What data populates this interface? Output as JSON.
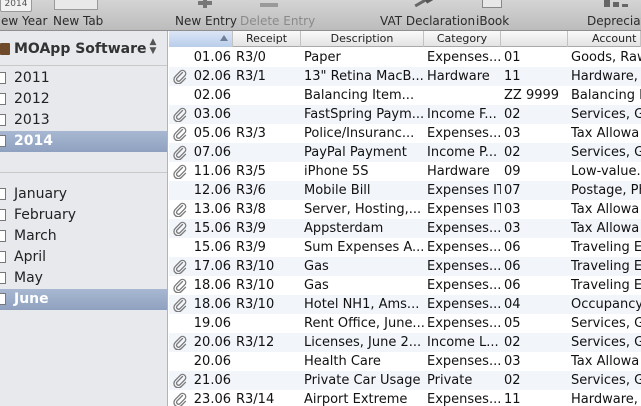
{
  "toolbar": {
    "new_year": "New Year",
    "new_tab": "New Tab",
    "new_entry": "New Entry",
    "delete_entry": "Delete Entry",
    "vat_declaration": "VAT Declaration",
    "ibook": "iBook",
    "depreciations": "Depreciations",
    "calendar_icon_text": "2014"
  },
  "sidebar": {
    "document_title": "MOApp Software",
    "years": [
      "2011",
      "2012",
      "2013",
      "2014"
    ],
    "selected_year": "2014",
    "months": [
      "January",
      "February",
      "March",
      "April",
      "May",
      "June"
    ],
    "selected_month": "June"
  },
  "table": {
    "columns": {
      "date": "",
      "receipt": "Receipt",
      "description": "Description",
      "category": "Category",
      "code": "",
      "account": "Account"
    },
    "rows": [
      {
        "attachment": false,
        "date": "01.06",
        "receipt": "R3/0",
        "description": "Paper",
        "category": "Expenses...",
        "code": "01",
        "account": "Goods, Raw"
      },
      {
        "attachment": true,
        "date": "02.06",
        "receipt": "R3/1",
        "description": "13\" Retina MacB...",
        "category": "Hardware",
        "code": "11",
        "account": "Hardware, T"
      },
      {
        "attachment": false,
        "date": "02.06",
        "receipt": "",
        "description": "Balancing Item...",
        "category": "",
        "code": "ZZ 9999",
        "account": "Balancing It"
      },
      {
        "attachment": true,
        "date": "03.06",
        "receipt": "",
        "description": "FastSpring Paym...",
        "category": "Income F...",
        "code": "02",
        "account": "Services, Ga"
      },
      {
        "attachment": true,
        "date": "05.06",
        "receipt": "R3/3",
        "description": "Police/Insuranc...",
        "category": "Expenses...",
        "code": "03",
        "account": "Tax Allowa"
      },
      {
        "attachment": true,
        "date": "07.06",
        "receipt": "",
        "description": "PayPal Payment",
        "category": "Income P...",
        "code": "02",
        "account": "Services, Ga"
      },
      {
        "attachment": true,
        "date": "11.06",
        "receipt": "R3/5",
        "description": "iPhone 5S",
        "category": "Hardware",
        "code": "09",
        "account": "Low-value..."
      },
      {
        "attachment": false,
        "date": "12.06",
        "receipt": "R3/6",
        "description": "Mobile Bill",
        "category": "Expenses IT",
        "code": "07",
        "account": "Postage, Ph"
      },
      {
        "attachment": true,
        "date": "13.06",
        "receipt": "R3/8",
        "description": "Server, Hosting,...",
        "category": "Expenses IT",
        "code": "03",
        "account": "Tax Allowa"
      },
      {
        "attachment": true,
        "date": "15.06",
        "receipt": "R3/9",
        "description": "Appsterdam",
        "category": "Expenses...",
        "code": "03",
        "account": "Tax Allowa"
      },
      {
        "attachment": false,
        "date": "15.06",
        "receipt": "R3/9",
        "description": "Sum Expenses A...",
        "category": "Expenses...",
        "code": "06",
        "account": "Traveling E"
      },
      {
        "attachment": true,
        "date": "17.06",
        "receipt": "R3/10",
        "description": "Gas",
        "category": "Expenses...",
        "code": "06",
        "account": "Traveling E"
      },
      {
        "attachment": true,
        "date": "18.06",
        "receipt": "R3/10",
        "description": "Gas",
        "category": "Expenses...",
        "code": "06",
        "account": "Traveling E"
      },
      {
        "attachment": true,
        "date": "18.06",
        "receipt": "R3/10",
        "description": "Hotel NH1, Ams...",
        "category": "Expenses...",
        "code": "04",
        "account": "Occupancy"
      },
      {
        "attachment": false,
        "date": "19.06",
        "receipt": "",
        "description": "Rent Office, June...",
        "category": "Expenses...",
        "code": "05",
        "account": "Services, Ga"
      },
      {
        "attachment": true,
        "date": "20.06",
        "receipt": "R3/12",
        "description": "Licenses, June 2...",
        "category": "Income L...",
        "code": "02",
        "account": "Services, Ga"
      },
      {
        "attachment": false,
        "date": "20.06",
        "receipt": "",
        "description": "Health Care",
        "category": "Expenses...",
        "code": "03",
        "account": "Tax Allowa"
      },
      {
        "attachment": true,
        "date": "21.06",
        "receipt": "",
        "description": "Private Car Usage",
        "category": "Private",
        "code": "02",
        "account": "Services, Ga"
      },
      {
        "attachment": true,
        "date": "23.06",
        "receipt": "R3/14",
        "description": "Airport Extreme",
        "category": "Expenses...",
        "code": "11",
        "account": "Hardware, T"
      }
    ]
  }
}
